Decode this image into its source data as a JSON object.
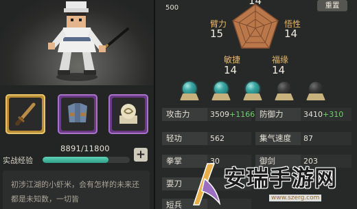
{
  "character": {
    "exp_label": "实战经验",
    "exp_value": "8891/11800",
    "exp_progress": 0.753,
    "exp_plus": "+",
    "description": "初涉江湖的小虾米，会有怎样的未来还都是未知数，一切皆"
  },
  "equipment": [
    {
      "slot": "weapon",
      "icon": "sword-icon",
      "frame": "gold"
    },
    {
      "slot": "armor",
      "icon": "armor-icon",
      "frame": "purple"
    },
    {
      "slot": "accessory",
      "icon": "jade-pendant-icon",
      "frame": "purple"
    }
  ],
  "top_bar": {
    "coin_value": "500",
    "reset_label": "重置"
  },
  "attributes": [
    {
      "key": "top",
      "name": "",
      "value": "14"
    },
    {
      "key": "arm",
      "name": "臂力",
      "value": "15"
    },
    {
      "key": "comprehension",
      "name": "悟性",
      "value": "14"
    },
    {
      "key": "agility",
      "name": "敏捷",
      "value": "14"
    },
    {
      "key": "fortune",
      "name": "福缘",
      "value": "14"
    }
  ],
  "orbs": [
    "teal",
    "teal",
    "teal",
    "dark",
    "dark"
  ],
  "stats": [
    {
      "label": "攻击力",
      "value": "3509",
      "bonus": "+1166"
    },
    {
      "label": "防御力",
      "value": "3410",
      "bonus": "+310"
    },
    {
      "label": "轻功",
      "value": "562",
      "bonus": ""
    },
    {
      "label": "集气速度",
      "value": "87",
      "bonus": ""
    },
    {
      "label": "拳掌",
      "value": "30",
      "bonus": ""
    },
    {
      "label": "御剑",
      "value": "203",
      "bonus": ""
    },
    {
      "label": "耍刀",
      "value": "",
      "bonus": ""
    },
    {
      "label": "短兵",
      "value": "",
      "bonus": ""
    }
  ],
  "watermark": {
    "text": "安瑞手游网",
    "url": "www.szerg.com"
  },
  "colors": {
    "gold_frame": "#b98e36",
    "purple_frame": "#6b3a86",
    "exp_bar": "#3fb59d",
    "bonus_green": "#6fd26a",
    "attribute_label": "#e4b96a"
  }
}
